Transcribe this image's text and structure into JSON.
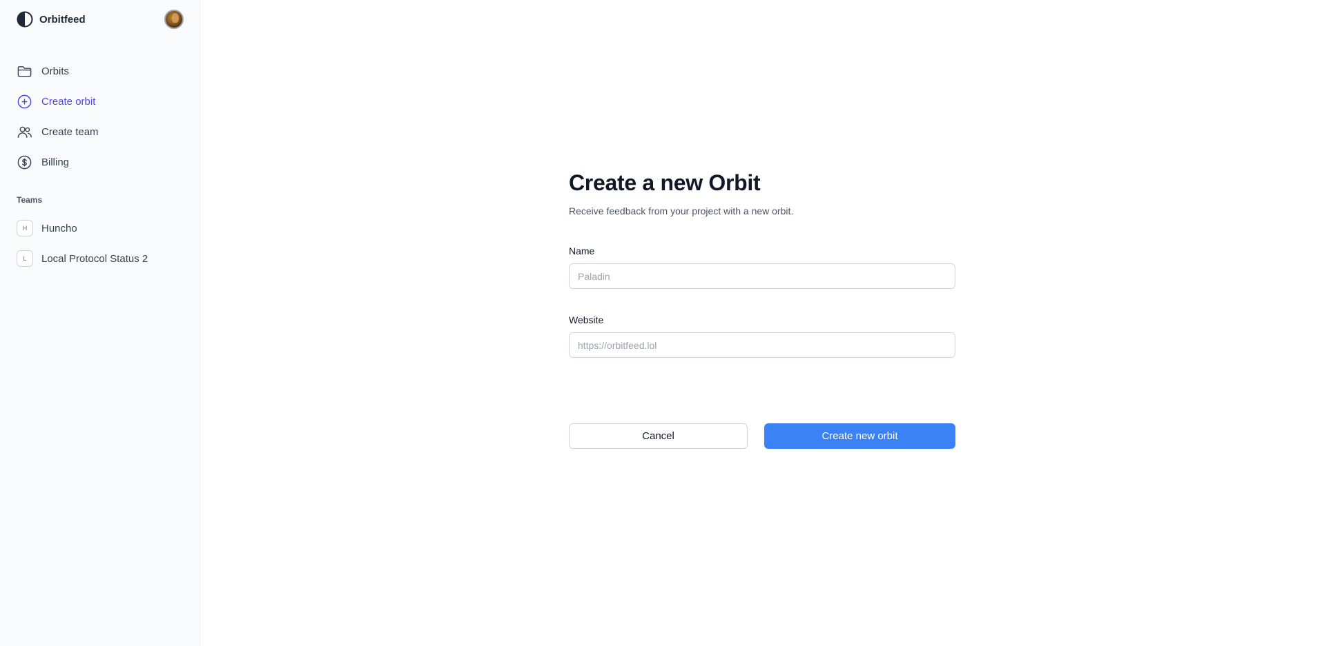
{
  "brand": {
    "name": "Orbitfeed",
    "logo_icon": "half-circle-logo-icon"
  },
  "user": {
    "avatar_icon": "user-avatar"
  },
  "sidebar": {
    "nav": [
      {
        "label": "Orbits",
        "icon": "folder-icon",
        "active": false
      },
      {
        "label": "Create orbit",
        "icon": "plus-circle-icon",
        "active": true
      },
      {
        "label": "Create team",
        "icon": "users-icon",
        "active": false
      },
      {
        "label": "Billing",
        "icon": "dollar-circle-icon",
        "active": false
      }
    ],
    "teams_heading": "Teams",
    "teams": [
      {
        "initial": "H",
        "label": "Huncho"
      },
      {
        "initial": "L",
        "label": "Local Protocol Status 2"
      }
    ]
  },
  "form": {
    "title": "Create a new Orbit",
    "subtitle": "Receive feedback from your project with a new orbit.",
    "name": {
      "label": "Name",
      "value": "",
      "placeholder": "Paladin"
    },
    "website": {
      "label": "Website",
      "value": "",
      "placeholder": "https://orbitfeed.lol"
    },
    "cancel_label": "Cancel",
    "submit_label": "Create new orbit"
  },
  "colors": {
    "accent": "#4f46e5",
    "primary_button": "#3b82f6",
    "sidebar_bg": "#f9fafb"
  }
}
